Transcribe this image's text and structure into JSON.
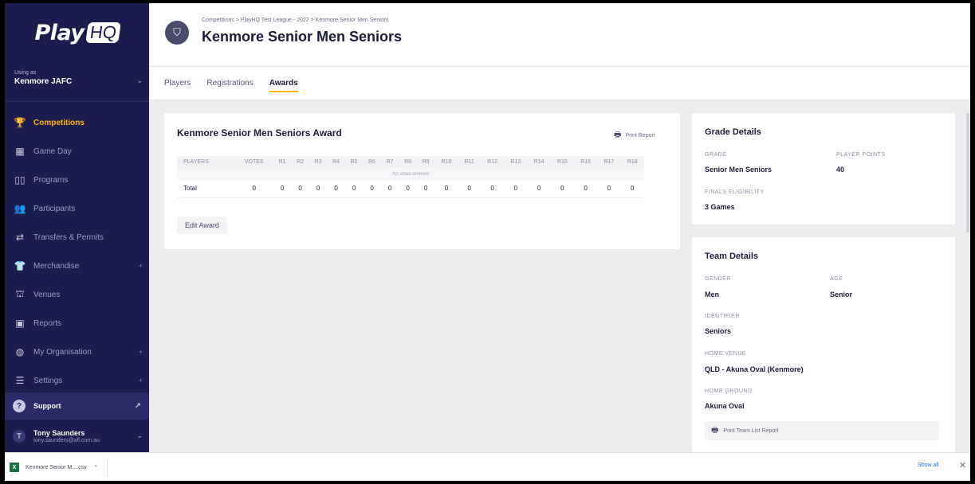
{
  "app": {
    "logo_text": "Play",
    "logo_badge": "HQ"
  },
  "org": {
    "using_label": "Using as",
    "name": "Kenmore JAFC"
  },
  "sidebar": {
    "items": [
      {
        "label": "Competitions",
        "icon": "trophy-icon",
        "glyph": "🏆",
        "active": true,
        "plus": false
      },
      {
        "label": "Game Day",
        "icon": "scoreboard-icon",
        "glyph": "▦",
        "active": false,
        "plus": false
      },
      {
        "label": "Programs",
        "icon": "book-icon",
        "glyph": "▯▯",
        "active": false,
        "plus": false
      },
      {
        "label": "Participants",
        "icon": "people-icon",
        "glyph": "👥",
        "active": false,
        "plus": false
      },
      {
        "label": "Transfers & Permits",
        "icon": "transfer-icon",
        "glyph": "⇄",
        "active": false,
        "plus": false
      },
      {
        "label": "Merchandise",
        "icon": "shirt-icon",
        "glyph": "👕",
        "active": false,
        "plus": true
      },
      {
        "label": "Venues",
        "icon": "stadium-icon",
        "glyph": "⛫",
        "active": false,
        "plus": false
      },
      {
        "label": "Reports",
        "icon": "report-icon",
        "glyph": "▣",
        "active": false,
        "plus": false
      },
      {
        "label": "My Organisation",
        "icon": "globe-icon",
        "glyph": "◍",
        "active": false,
        "plus": true
      },
      {
        "label": "Settings",
        "icon": "sliders-icon",
        "glyph": "☰",
        "active": false,
        "plus": true
      }
    ],
    "plus_glyph": "+"
  },
  "support": {
    "label": "Support",
    "icon_glyph": "?",
    "ext_glyph": "↗"
  },
  "user": {
    "initial": "T",
    "name": "Tony Saunders",
    "email": "tony.saunders@afl.com.au"
  },
  "header": {
    "breadcrumb": "Competitions  >  PlayHQ Test League - 2022  >  Kenmore Senior Men Seniors",
    "title": "Kenmore Senior Men Seniors",
    "icon_glyph": "⛉"
  },
  "tabs": [
    {
      "label": "Players",
      "active": false
    },
    {
      "label": "Registrations",
      "active": false
    },
    {
      "label": "Awards",
      "active": true
    }
  ],
  "award": {
    "title": "Kenmore Senior Men Seniors Award",
    "print_label": "Print Report",
    "print_glyph": "🖶",
    "columns": [
      "PLAYERS",
      "VOTES",
      "R1",
      "R2",
      "R3",
      "R4",
      "R5",
      "R6",
      "R7",
      "R8",
      "R9",
      "R10",
      "R11",
      "R12",
      "R13",
      "R14",
      "R15",
      "R16",
      "R17",
      "R18"
    ],
    "empty_message": "No votes entered",
    "total_row": [
      "Total",
      "0",
      "0",
      "0",
      "0",
      "0",
      "0",
      "0",
      "0",
      "0",
      "0",
      "0",
      "0",
      "0",
      "0",
      "0",
      "0",
      "0",
      "0",
      "0"
    ],
    "edit_label": "Edit Award"
  },
  "grade_details": {
    "title": "Grade Details",
    "grade_label": "GRADE",
    "grade_value": "Senior Men Seniors",
    "points_label": "PLAYER POINTS",
    "points_value": "40",
    "finals_label": "FINALS ELIGIBILITY",
    "finals_value": "3 Games"
  },
  "team_details": {
    "title": "Team Details",
    "gender_label": "GENDER",
    "gender_value": "Men",
    "age_label": "AGE",
    "age_value": "Senior",
    "identifier_label": "IDENTIFIER",
    "identifier_value": "Seniors",
    "venue_label": "HOME VENUE",
    "venue_value": "QLD - Akuna Oval (Kenmore)",
    "ground_label": "HOME GROUND",
    "ground_value": "Akuna Oval",
    "print_label": "Print Team List Report"
  },
  "download": {
    "file_name": "Kenmore Senior M....csv",
    "file_icon": "X",
    "chevron": "^",
    "show_all": "Show all",
    "close_glyph": "✕"
  },
  "colors": {
    "sidebar_bg": "#1c1c4e",
    "accent": "#ffb400"
  }
}
